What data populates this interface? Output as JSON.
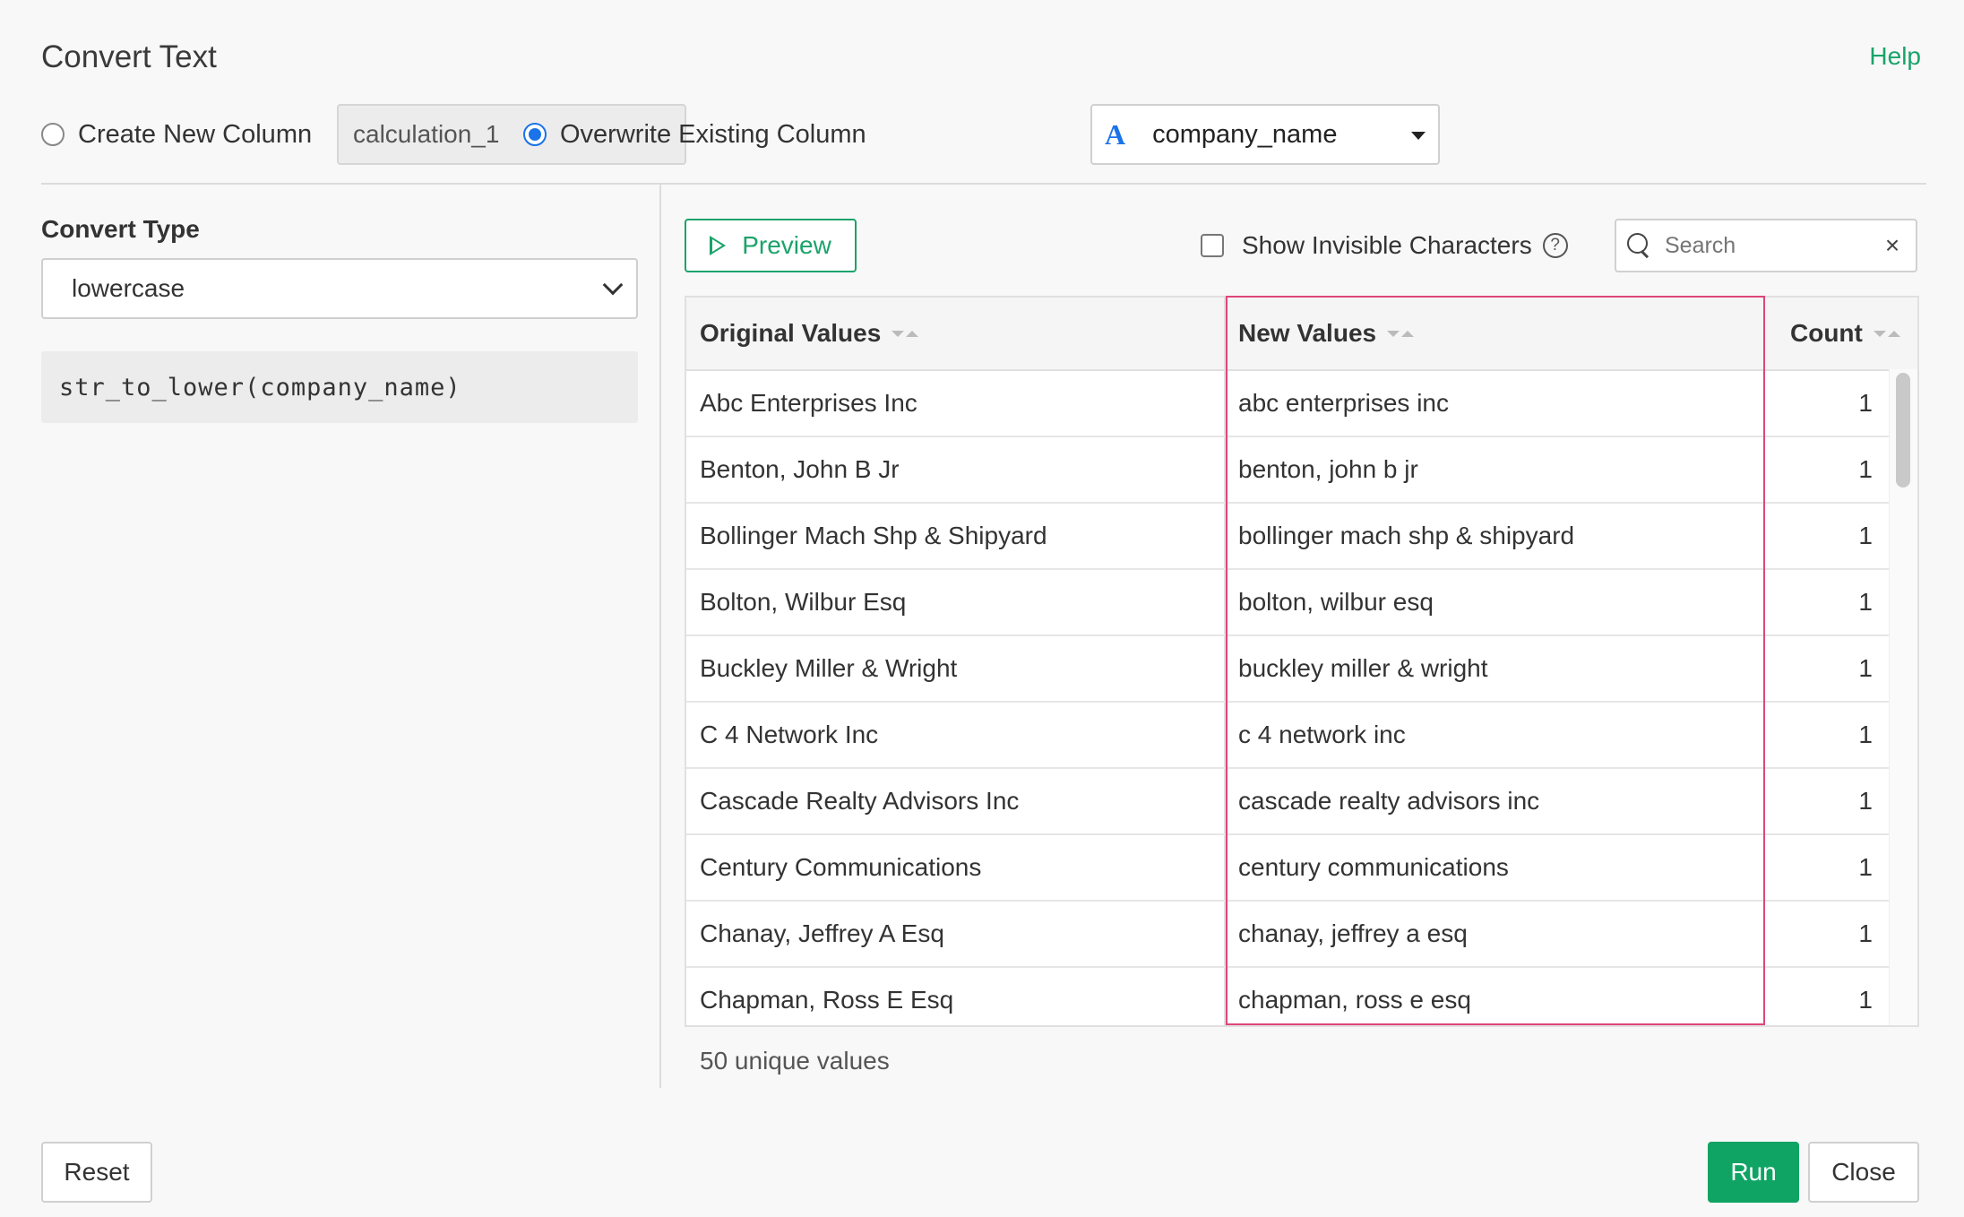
{
  "dialog": {
    "title": "Convert Text",
    "help_label": "Help"
  },
  "target": {
    "create_new_label": "Create New Column",
    "create_new_value": "calculation_1",
    "overwrite_label": "Overwrite Existing Column",
    "selected_mode": "overwrite",
    "column_type_icon": "A",
    "column_value": "company_name"
  },
  "convert": {
    "label": "Convert Type",
    "selected": "lowercase",
    "expression": "str_to_lower(company_name)"
  },
  "toolbar": {
    "preview_label": "Preview",
    "show_invisible_label": "Show Invisible Characters",
    "show_invisible_checked": false,
    "search_placeholder": "Search"
  },
  "table": {
    "columns": [
      "Original Values",
      "New Values",
      "Count"
    ],
    "rows": [
      {
        "original": "Abc Enterprises Inc",
        "new": "abc enterprises inc",
        "count": "1"
      },
      {
        "original": "Benton, John B Jr",
        "new": "benton, john b jr",
        "count": "1"
      },
      {
        "original": "Bollinger Mach Shp & Shipyard",
        "new": "bollinger mach shp & shipyard",
        "count": "1"
      },
      {
        "original": "Bolton, Wilbur Esq",
        "new": "bolton, wilbur esq",
        "count": "1"
      },
      {
        "original": "Buckley Miller & Wright",
        "new": "buckley miller & wright",
        "count": "1"
      },
      {
        "original": "C 4 Network Inc",
        "new": "c 4 network inc",
        "count": "1"
      },
      {
        "original": "Cascade Realty Advisors Inc",
        "new": "cascade realty advisors inc",
        "count": "1"
      },
      {
        "original": "Century Communications",
        "new": "century communications",
        "count": "1"
      },
      {
        "original": "Chanay, Jeffrey A Esq",
        "new": "chanay, jeffrey a esq",
        "count": "1"
      },
      {
        "original": "Chapman, Ross E Esq",
        "new": "chapman, ross e esq",
        "count": "1"
      }
    ],
    "summary": "50 unique values"
  },
  "footer": {
    "reset_label": "Reset",
    "run_label": "Run",
    "close_label": "Close"
  },
  "colors": {
    "accent_green": "#1aa36a",
    "radio_blue": "#1a73e8",
    "highlight_pink": "#e0457b"
  }
}
